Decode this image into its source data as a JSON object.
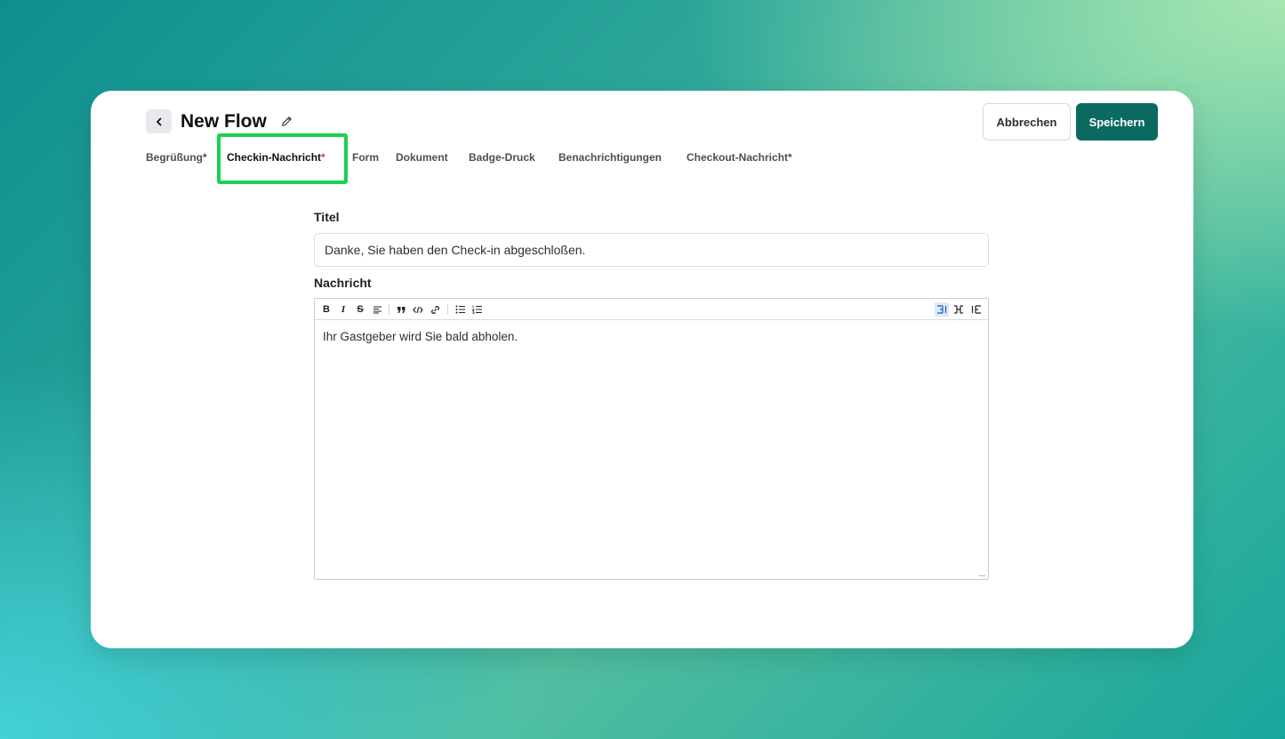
{
  "header": {
    "title": "New Flow",
    "cancel_label": "Abbrechen",
    "save_label": "Speichern"
  },
  "tabs": [
    {
      "label": "Begrüßung",
      "required": "*",
      "active": false
    },
    {
      "label": "Checkin-Nachricht",
      "required": "*",
      "active": true
    },
    {
      "label": "Form",
      "required": "",
      "active": false
    },
    {
      "label": "Dokument",
      "required": "",
      "active": false
    },
    {
      "label": "Badge-Druck",
      "required": "",
      "active": false
    },
    {
      "label": "Benachrichtigungen",
      "required": "",
      "active": false
    },
    {
      "label": "Checkout-Nachricht",
      "required": "*",
      "active": false
    }
  ],
  "form": {
    "title_label": "Titel",
    "title_value": "Danke, Sie haben den Check-in abgeschloßen.",
    "message_label": "Nachricht",
    "message_value": "Ihr Gastgeber wird Sie bald abholen."
  },
  "toolbar": {
    "bold": "B",
    "italic": "I",
    "strike": "S",
    "resize_handle": "..."
  },
  "colors": {
    "primary": "#0b6a60",
    "highlight": "#1ad14f",
    "required_active": "#d93b3b"
  }
}
